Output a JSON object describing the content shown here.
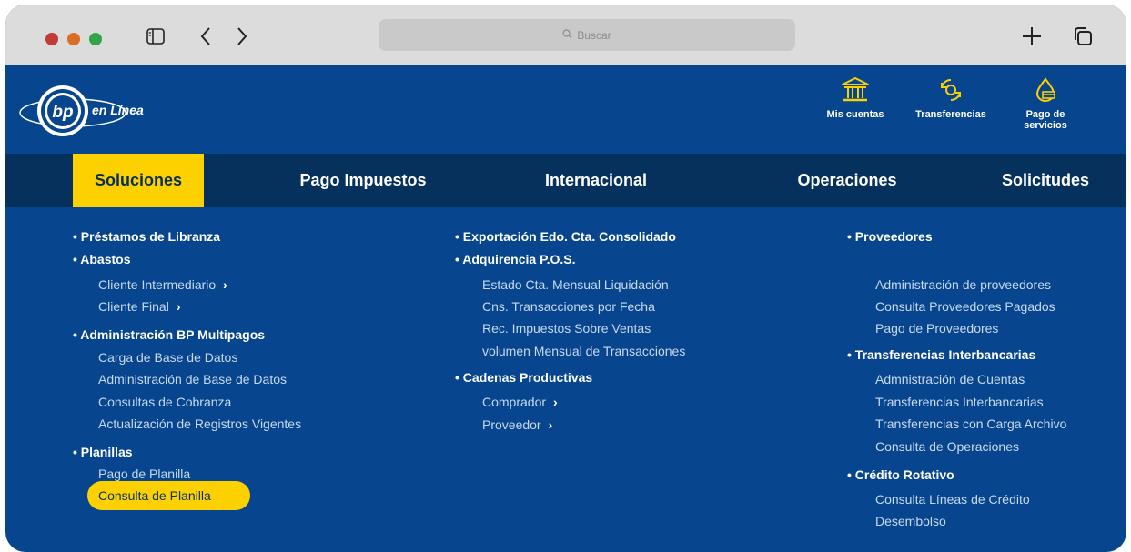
{
  "browser": {
    "search_placeholder": "Buscar",
    "traffic_lights": [
      "#c13c34",
      "#dd6c25",
      "#33a447"
    ],
    "icons": [
      "sidebar-icon",
      "back-icon",
      "forward-icon",
      "search-icon",
      "plus-icon",
      "tabs-icon"
    ]
  },
  "header": {
    "logo_text": "bp",
    "logo_subtitle": "en Línea",
    "actions": {
      "cuentas": "Mis cuentas",
      "transferencias": "Transferencias",
      "pago_line1": "Pago de",
      "pago_line2": "servicios"
    }
  },
  "nav": {
    "soluciones": "Soluciones",
    "pago_impuestos": "Pago Impuestos",
    "internacional": "Internacional",
    "operaciones": "Operaciones",
    "solicitudes": "Solicitudes"
  },
  "menu": {
    "col1": {
      "prestamos": "• Préstamos de Libranza",
      "abastos": "• Abastos",
      "cliente_intermediario": "Cliente Intermediario",
      "cliente_final": "Cliente Final",
      "admin_bp": "• Administración BP Multipagos",
      "carga_base": "Carga de Base de Datos",
      "admin_base": "Administración de Base de Datos",
      "consultas_cobranza": "Consultas de Cobranza",
      "actualizacion": "Actualización de Registros Vigentes",
      "planillas": "• Planillas",
      "pago_planilla": "Pago de Planilla",
      "consulta_planilla": "Consulta de Planilla"
    },
    "col2": {
      "exportacion": "• Exportación  Edo. Cta. Consolidado",
      "adquirencia": "• Adquirencia P.O.S.",
      "estado_cta": "Estado Cta. Mensual Liquidación",
      "cns_trans": "Cns. Transacciones por Fecha",
      "rec_impuestos": "Rec. Impuestos Sobre Ventas",
      "volumen": "volumen Mensual de Transacciones",
      "cadenas": "• Cadenas Productivas",
      "comprador": "Comprador",
      "proveedor": "Proveedor"
    },
    "col3": {
      "proveedores": "• Proveedores",
      "admin_proveedores": "Administración de proveedores",
      "consulta_pagados": "Consulta Proveedores Pagados",
      "pago_proveedores": "Pago de Proveedores",
      "transf_inter": "• Transferencias Interbancarias",
      "admin_cuentas": "Admnistración de Cuentas",
      "transf_interbancarias": "Transferencias Interbancarias",
      "transf_carga": "Transferencias con Carga Archivo",
      "consulta_operaciones": "Consulta de Operaciones",
      "credito": "• Crédito Rotativo",
      "consulta_lineas": "Consulta Líneas de Crédito",
      "desembolso": "Desembolso"
    }
  },
  "colors": {
    "brand_blue": "#07468f",
    "nav_dark": "#05315c",
    "accent_yellow": "#fdd000",
    "link_blue": "#c7d9ef"
  }
}
